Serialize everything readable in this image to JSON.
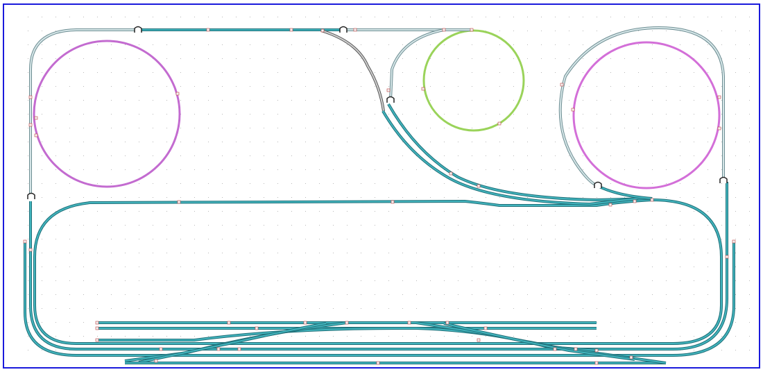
{
  "canvas": {
    "border_color": "#1a1adc",
    "background": "#ffffff",
    "grid_dot_color": "#b8b8b8"
  },
  "colors": {
    "main_track": "#2aa7b0",
    "main_track_dark": "#1f6f78",
    "upper_track": "#a9c4c8",
    "upper_track_dark": "#6f8f94",
    "helix_purple": "#c36bd0",
    "helix_green": "#9ad35a",
    "ramp_grey": "#8a8a8a",
    "joint_marker": "#e0e0e0",
    "joint_red": "#c04040"
  },
  "layout": {
    "description_visible": false
  }
}
